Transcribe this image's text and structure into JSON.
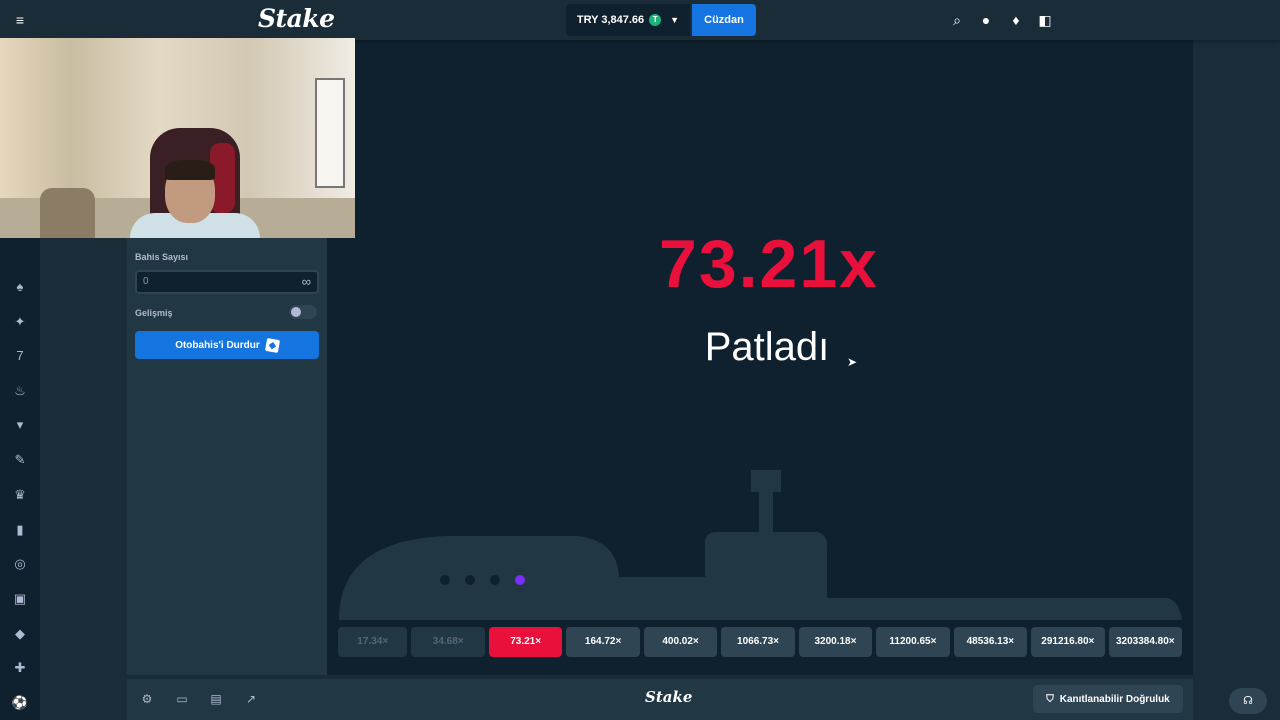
{
  "header": {
    "logo": "Stake",
    "balance": "TRY 3,847.66",
    "currency_coin": "T",
    "wallet_button": "Cüzdan",
    "icons": [
      "search-icon",
      "user-icon",
      "bell-icon",
      "sidebar-toggle-icon"
    ]
  },
  "left_nav": {
    "icons": [
      "menu-icon",
      "casino-icon",
      "star-icon",
      "sevens-icon",
      "fire-icon",
      "jersey-icon",
      "pen-icon",
      "crown-icon",
      "battery-icon",
      "target-icon",
      "gift-icon",
      "ticket-icon",
      "tools-icon",
      "soccer-icon"
    ]
  },
  "controls": {
    "bet_count_label": "Bahis Sayısı",
    "bet_count_value": "0",
    "infinity_symbol": "∞",
    "advanced_label": "Gelişmiş",
    "advanced_enabled": false,
    "stop_autobet_label": "Otobahis'i Durdur"
  },
  "game": {
    "multiplier": "73.21x",
    "status": "Patladı",
    "multiplier_color": "#e9113c",
    "history": [
      {
        "value": "17.34×",
        "state": "faded"
      },
      {
        "value": "34.68×",
        "state": "faded"
      },
      {
        "value": "73.21×",
        "state": "active"
      },
      {
        "value": "164.72×",
        "state": "normal"
      },
      {
        "value": "400.02×",
        "state": "normal"
      },
      {
        "value": "1066.73×",
        "state": "normal"
      },
      {
        "value": "3200.18×",
        "state": "normal"
      },
      {
        "value": "11200.65×",
        "state": "normal"
      },
      {
        "value": "48536.13×",
        "state": "normal"
      },
      {
        "value": "291216.80×",
        "state": "normal"
      },
      {
        "value": "3203384.80×",
        "state": "normal"
      }
    ]
  },
  "footer": {
    "logo": "Stake",
    "fairness_button": "Kanıtlanabilir Doğruluk",
    "icons": [
      "settings-icon",
      "theatre-mode-icon",
      "stats-icon",
      "popout-icon"
    ]
  },
  "colors": {
    "accent": "#1475e1",
    "background": "#0f212e",
    "panel": "#213743",
    "crash_red": "#e9113c"
  }
}
